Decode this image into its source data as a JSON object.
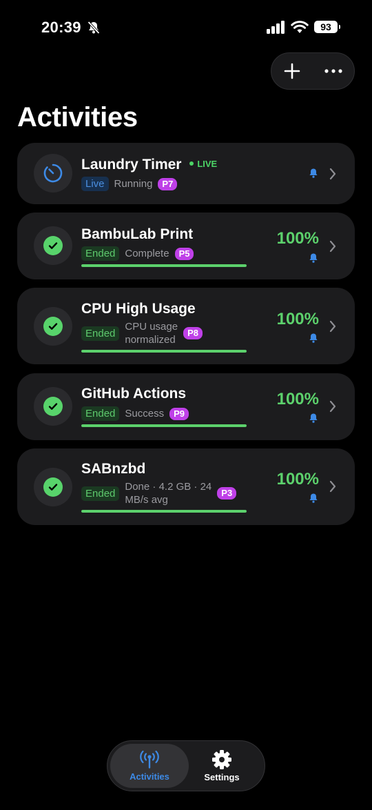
{
  "status_bar": {
    "time": "20:39",
    "battery": "93"
  },
  "page": {
    "title": "Activities"
  },
  "activities": [
    {
      "title": "Laundry Timer",
      "live_tag": "LIVE",
      "state": "Live",
      "status": "Running",
      "priority": "P7",
      "percent": null,
      "progress": null
    },
    {
      "title": "BambuLab Print",
      "state": "Ended",
      "status": "Complete",
      "priority": "P5",
      "percent": "100%",
      "progress": 1.0
    },
    {
      "title": "CPU High Usage",
      "state": "Ended",
      "status_line1": "CPU usage",
      "status_line2": "normalized",
      "priority": "P8",
      "percent": "100%",
      "progress": 1.0
    },
    {
      "title": "GitHub Actions",
      "state": "Ended",
      "status": "Success",
      "priority": "P9",
      "percent": "100%",
      "progress": 1.0
    },
    {
      "title": "SABnzbd",
      "state": "Ended",
      "status_line1": "Done · 4.2 GB · 24",
      "status_line2": "MB/s avg",
      "priority": "P3",
      "percent": "100%",
      "progress": 1.0
    }
  ],
  "tab_bar": {
    "activities_label": "Activities",
    "settings_label": "Settings",
    "selected": "Activities"
  },
  "colors": {
    "accent_blue": "#3d8ae6",
    "success_green": "#5cd16c",
    "priority_purple": "#bf40e8",
    "card_bg": "#1c1c1e"
  },
  "icons": [
    "bell-slash-icon",
    "cellular-signal-icon",
    "wifi-icon",
    "plus-icon",
    "more-icon",
    "timer-icon",
    "checkmark-icon",
    "bell-icon",
    "chevron-right-icon",
    "antenna-icon",
    "gear-icon"
  ]
}
